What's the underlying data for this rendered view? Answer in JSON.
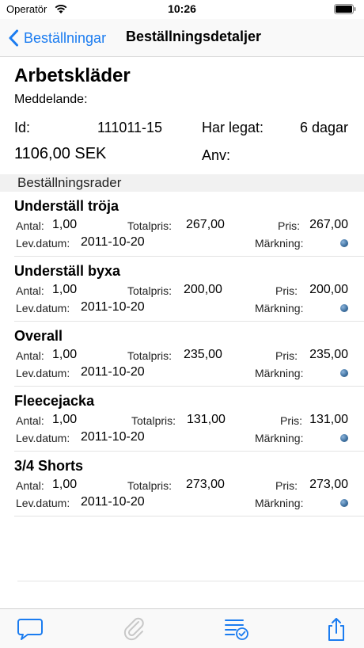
{
  "status_bar": {
    "carrier": "Operatör",
    "time": "10:26"
  },
  "nav": {
    "back_label": "Beställningar",
    "title": "Beställningsdetaljer"
  },
  "order": {
    "title": "Arbetskläder",
    "message_label": "Meddelande:",
    "id_label": "Id:",
    "id_value": "111011-15",
    "legat_label": "Har legat:",
    "legat_value": "6 dagar",
    "amount": "1106,00 SEK",
    "user_label": "Anv:"
  },
  "section": {
    "title": "Beställningsrader"
  },
  "row_labels": {
    "quantity": "Antal:",
    "total": "Totalpris:",
    "price": "Pris:",
    "date": "Lev.datum:",
    "marking": "Märkning:"
  },
  "rows": [
    {
      "name": "Underställ tröja",
      "quantity": "1,00",
      "total": "267,00",
      "price": "267,00",
      "date": "2011-10-20"
    },
    {
      "name": "Underställ byxa",
      "quantity": "1,00",
      "total": "200,00",
      "price": "200,00",
      "date": "2011-10-20"
    },
    {
      "name": "Overall",
      "quantity": "1,00",
      "total": "235,00",
      "price": "235,00",
      "date": "2011-10-20"
    },
    {
      "name": "Fleecejacka",
      "quantity": "1,00",
      "total": "131,00",
      "price": "131,00",
      "date": "2011-10-20"
    },
    {
      "name": "3/4 Shorts",
      "quantity": "1,00",
      "total": "273,00",
      "price": "273,00",
      "date": "2011-10-20"
    }
  ],
  "toolbar": {
    "items": [
      {
        "icon": "chat-bubble-icon",
        "enabled": true
      },
      {
        "icon": "paperclip-icon",
        "enabled": false
      },
      {
        "icon": "list-check-icon",
        "enabled": true
      },
      {
        "icon": "share-icon",
        "enabled": true
      }
    ]
  },
  "colors": {
    "accent": "#1b7cf0",
    "disabled": "#c8c8c8",
    "marking": "#3b6e9e"
  }
}
